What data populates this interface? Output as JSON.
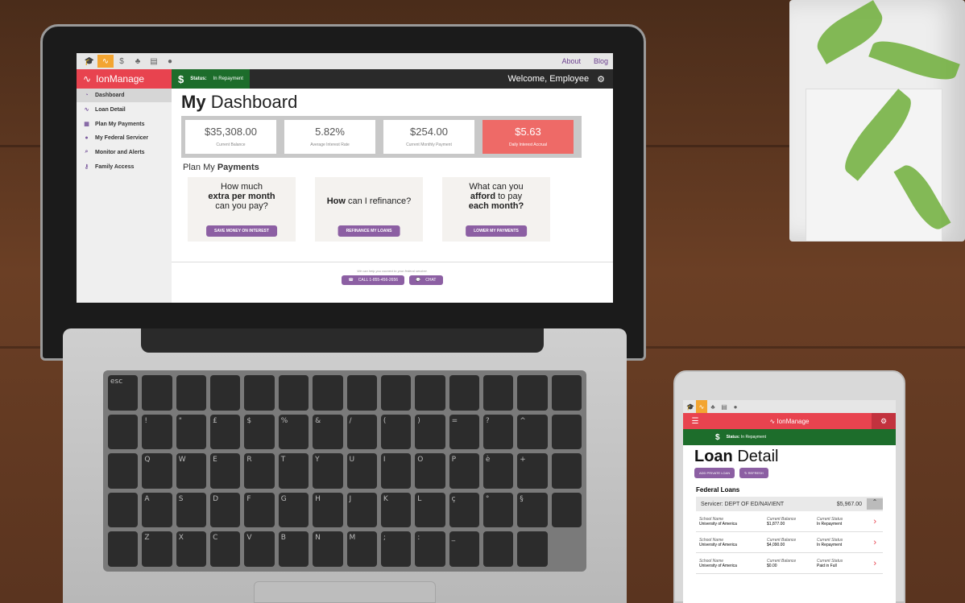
{
  "app": {
    "brand": "IonManage",
    "top_links": [
      "About",
      "Blog"
    ],
    "status_label": "Status:",
    "status_value": "In Repayment",
    "welcome": "Welcome, Employee"
  },
  "sidebar": {
    "items": [
      {
        "label": "Dashboard",
        "icon": "dashboard-icon"
      },
      {
        "label": "Loan Detail",
        "icon": "pulse-icon"
      },
      {
        "label": "Plan My Payments",
        "icon": "calendar-icon"
      },
      {
        "label": "My Federal Servicer",
        "icon": "info-icon"
      },
      {
        "label": "Monitor and Alerts",
        "icon": "search-icon"
      },
      {
        "label": "Family Access",
        "icon": "key-icon"
      }
    ]
  },
  "main": {
    "title_bold": "My",
    "title_rest": "Dashboard",
    "stats": [
      {
        "value": "$35,308.00",
        "label": "Current Balance"
      },
      {
        "value": "5.82%",
        "label": "Average Interest Rate"
      },
      {
        "value": "$254.00",
        "label": "Current Monthly Payment"
      },
      {
        "value": "$5.63",
        "label": "Daily Interest Accrual"
      }
    ],
    "plan_plain": "Plan My",
    "plan_bold": "Payments",
    "cards": [
      {
        "line1": "How much",
        "line2": "extra per month",
        "line3": "can you pay?",
        "button": "SAVE MONEY ON INTEREST"
      },
      {
        "line1": "How",
        "line2": "can I refinance?",
        "button": "REFINANCE MY LOANS"
      },
      {
        "line1": "What can you",
        "line2a": "afford",
        "line2b": "to pay",
        "line3": "each month?",
        "button": "LOWER MY PAYMENTS"
      }
    ],
    "footer_text": "We can help you connect to your federal servicer.",
    "call_label": "CALL 1-855-456-2656",
    "chat_label": "CHAT"
  },
  "tablet": {
    "brand": "IonManage",
    "status_label": "Status:",
    "status_value": "In Repayment",
    "title_bold": "Loan",
    "title_rest": "Detail",
    "add_label": "ADD PRIVATE LOAN",
    "refresh_label": "REFRESH",
    "section": "Federal Loans",
    "servicer": "Servicer: DEPT OF ED/NAVIENT",
    "servicer_amount": "$5,967.00",
    "loans": [
      {
        "school_label": "School Name",
        "school": "University of America",
        "bal_label": "Current Balance",
        "balance": "$1,877.00",
        "status_label": "Current Status",
        "status": "In Repayment"
      },
      {
        "school_label": "School Name",
        "school": "University of America",
        "bal_label": "Current Balance",
        "balance": "$4,090.00",
        "status_label": "Current Status",
        "status": "In Repayment"
      },
      {
        "school_label": "School Name",
        "school": "University of America",
        "bal_label": "Current Balance",
        "balance": "$0.00",
        "status_label": "Current Status",
        "status": "Paid in Full"
      }
    ]
  },
  "keyboard": {
    "keys": [
      "esc",
      "",
      "",
      "",
      "",
      "",
      "",
      "",
      "",
      "",
      "",
      "",
      "",
      "",
      "",
      "!",
      "\"",
      "£",
      "$",
      "%",
      "&",
      "/",
      "(",
      ")",
      "=",
      "?",
      "^",
      "",
      "",
      "Q",
      "W",
      "E",
      "R",
      "T",
      "Y",
      "U",
      "I",
      "O",
      "P",
      "è",
      "+",
      "",
      "",
      "A",
      "S",
      "D",
      "F",
      "G",
      "H",
      "J",
      "K",
      "L",
      "ç",
      "°",
      "§",
      "",
      "",
      "Z",
      "X",
      "C",
      "V",
      "B",
      "N",
      "M",
      ";",
      ":",
      "_",
      "",
      ""
    ]
  },
  "colors": {
    "brand": "#e8434f",
    "status": "#1d6d2b",
    "accent": "#8c5fa3"
  }
}
